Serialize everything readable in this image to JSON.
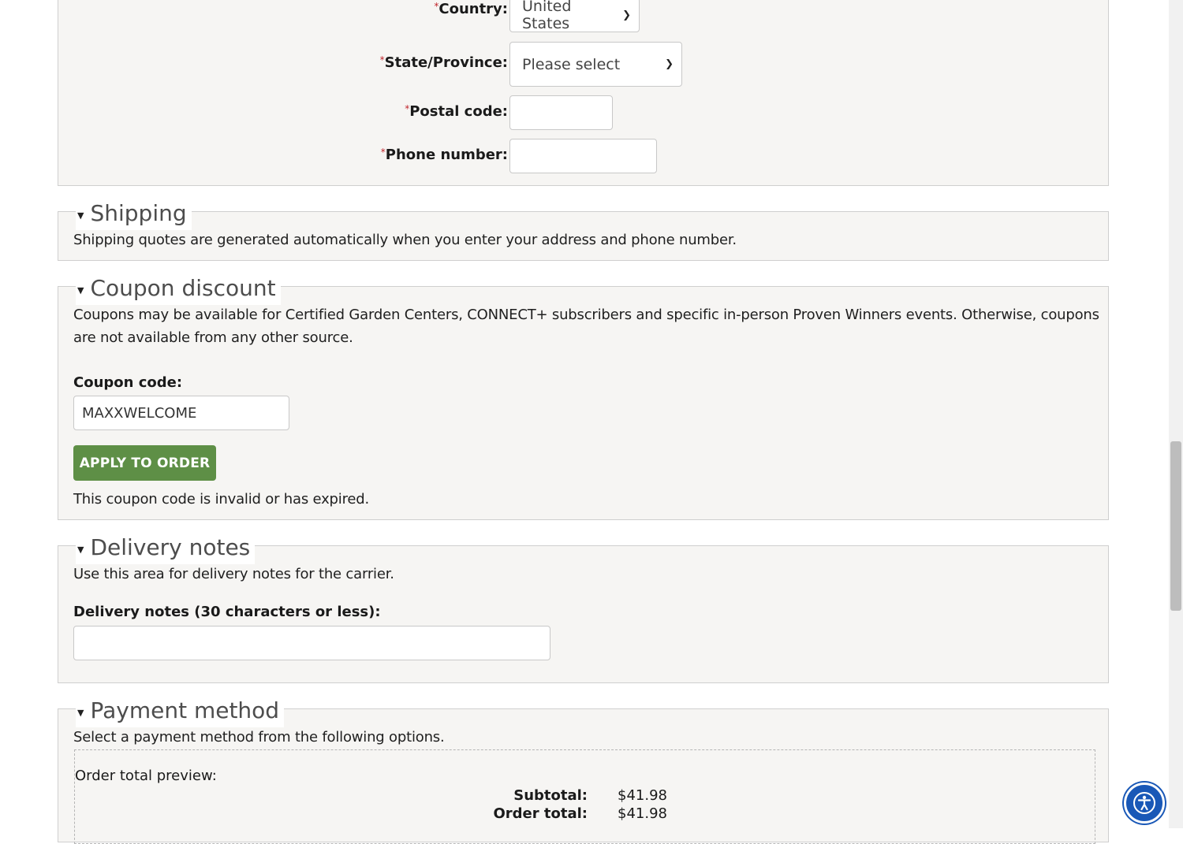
{
  "address": {
    "country_label": "Country:",
    "country_value": "United States",
    "state_label": "State/Province:",
    "state_value": "Please select",
    "postal_label": "Postal code:",
    "postal_value": "",
    "phone_label": "Phone number:",
    "phone_value": "",
    "required_marker": "*"
  },
  "shipping": {
    "title": "Shipping",
    "description": "Shipping quotes are generated automatically when you enter your address and phone number."
  },
  "coupon": {
    "title": "Coupon discount",
    "description_line1": "Coupons may be available for Certified Garden Centers, CONNECT+ subscribers and specific in-person Proven Winners events. Otherwise, coupons",
    "description_line2": "are not available from any other source.",
    "code_label": "Coupon code:",
    "code_value": "MAXXWELCOME",
    "apply_button": "APPLY TO ORDER",
    "message": "This coupon code is invalid or has expired."
  },
  "delivery": {
    "title": "Delivery notes",
    "description": "Use this area for delivery notes for the carrier.",
    "notes_label": "Delivery notes (30 characters or less):",
    "notes_value": ""
  },
  "payment": {
    "title": "Payment method",
    "description": "Select a payment method from the following options.",
    "preview_label": "Order total preview:",
    "subtotal_label": "Subtotal:",
    "subtotal_value": "$41.98",
    "total_label": "Order total:",
    "total_value": "$41.98"
  },
  "icons": {
    "collapse": "collapse-triangle-icon",
    "select_arrow": "chevron-down-icon",
    "accessibility": "accessibility-icon"
  },
  "colors": {
    "apply_button": "#5e8f46",
    "panel_bg": "#f6f5f3",
    "required": "#c0262d",
    "accessibility": "#1958b7"
  }
}
